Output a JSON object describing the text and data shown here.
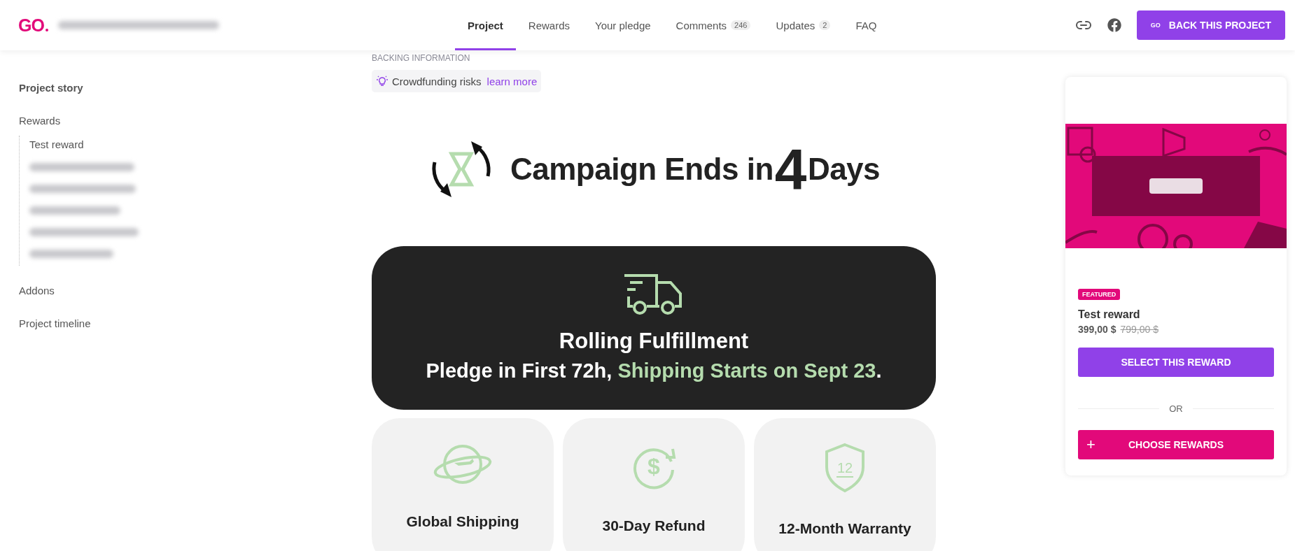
{
  "header": {
    "logo": "GO",
    "nav": [
      {
        "label": "Project",
        "selected": true
      },
      {
        "label": "Rewards",
        "selected": false
      },
      {
        "label": "Your pledge",
        "selected": false
      },
      {
        "label": "Comments",
        "count": "246",
        "selected": false
      },
      {
        "label": "Updates",
        "count": "2",
        "selected": false
      },
      {
        "label": "FAQ",
        "selected": false
      }
    ],
    "back_button": {
      "logo": "GO",
      "label": "BACK THIS PROJECT"
    }
  },
  "sidebar": {
    "items": [
      {
        "label": "Project story",
        "selected": true
      },
      {
        "label": "Rewards",
        "selected": false,
        "children": [
          {
            "label": "Test reward"
          }
        ]
      },
      {
        "label": "Addons",
        "selected": false
      },
      {
        "label": "Project timeline",
        "selected": false
      }
    ]
  },
  "backing": {
    "heading": "BACKING INFORMATION",
    "risks": "Crowdfunding risks",
    "link": "learn more"
  },
  "countdown": {
    "prefix": "Campaign Ends in",
    "number": "4",
    "suffix": "Days"
  },
  "fulfillment": {
    "title": "Rolling Fulfillment",
    "lead": "Pledge in First 72h,",
    "highlight": "Shipping Starts on Sept 23",
    "end": "."
  },
  "features": [
    {
      "kind": "globe",
      "label": "Global Shipping"
    },
    {
      "kind": "refund",
      "label": "30-Day Refund",
      "icon_text": "$"
    },
    {
      "kind": "shield",
      "label": "12-Month Warranty",
      "icon_text": "12"
    }
  ],
  "reward": {
    "badge": "FEATURED",
    "title": "Test reward",
    "price": "399,00 $",
    "old_price": "799,00 $",
    "select_button": "SELECT THIS REWARD",
    "divider": "OR",
    "choose_button": {
      "icon": "+",
      "label": "CHOOSE REWARDS"
    }
  }
}
